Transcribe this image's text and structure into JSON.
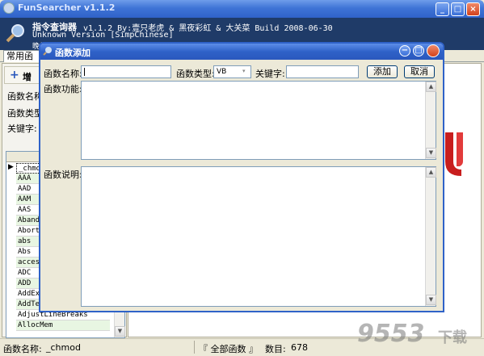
{
  "window": {
    "title": "FunSearcher v1.1.2",
    "min": "_",
    "max": "□",
    "close": "×"
  },
  "header": {
    "app_name": "指令查询器",
    "version_line": "v1.1.2  By:壹只老虎 & 黑夜彩虹 & 大关菜  Build 2008-06-30",
    "unknown_version": "Unknown Version [SimpChinese]",
    "row3": "晚礼  韩国  ..."
  },
  "tabs": [
    "常用函"
  ],
  "left_panel": {
    "add_button": "增",
    "name_label": "函数名称",
    "type_label": "函数类型",
    "keyword_label": "关键字:",
    "current_marker": "▶",
    "list": [
      "_chmod",
      "AAA",
      "AAD",
      "AAM",
      "AAS",
      "Abando",
      "Abort",
      "abs",
      "Abs",
      "access",
      "ADC",
      "ADD",
      "AddExi",
      "AddTer",
      "AdjustLineBreaks",
      "AllocMem"
    ]
  },
  "dialog": {
    "title": "函数添加",
    "name_label": "函数名称:",
    "type_label": "函数类型:",
    "type_value": "VB",
    "keyword_label": "关键字:",
    "add_button": "添加",
    "cancel_button": "取消",
    "function_label": "函数功能:",
    "desc_label": "函数说明:"
  },
  "status": {
    "name_label": "函数名称:",
    "name_value": "_chmod",
    "all_functions": "『 全部函数 』",
    "count_label": "数目:",
    "count_value": "678"
  },
  "watermark": {
    "text": "9553",
    "sub": "下载"
  },
  "colors": {
    "title_blue": "#2f62c8",
    "header_bg": "#1f3b68",
    "list_green": "#e8f6e2",
    "logo_red": "#c81e1e"
  }
}
